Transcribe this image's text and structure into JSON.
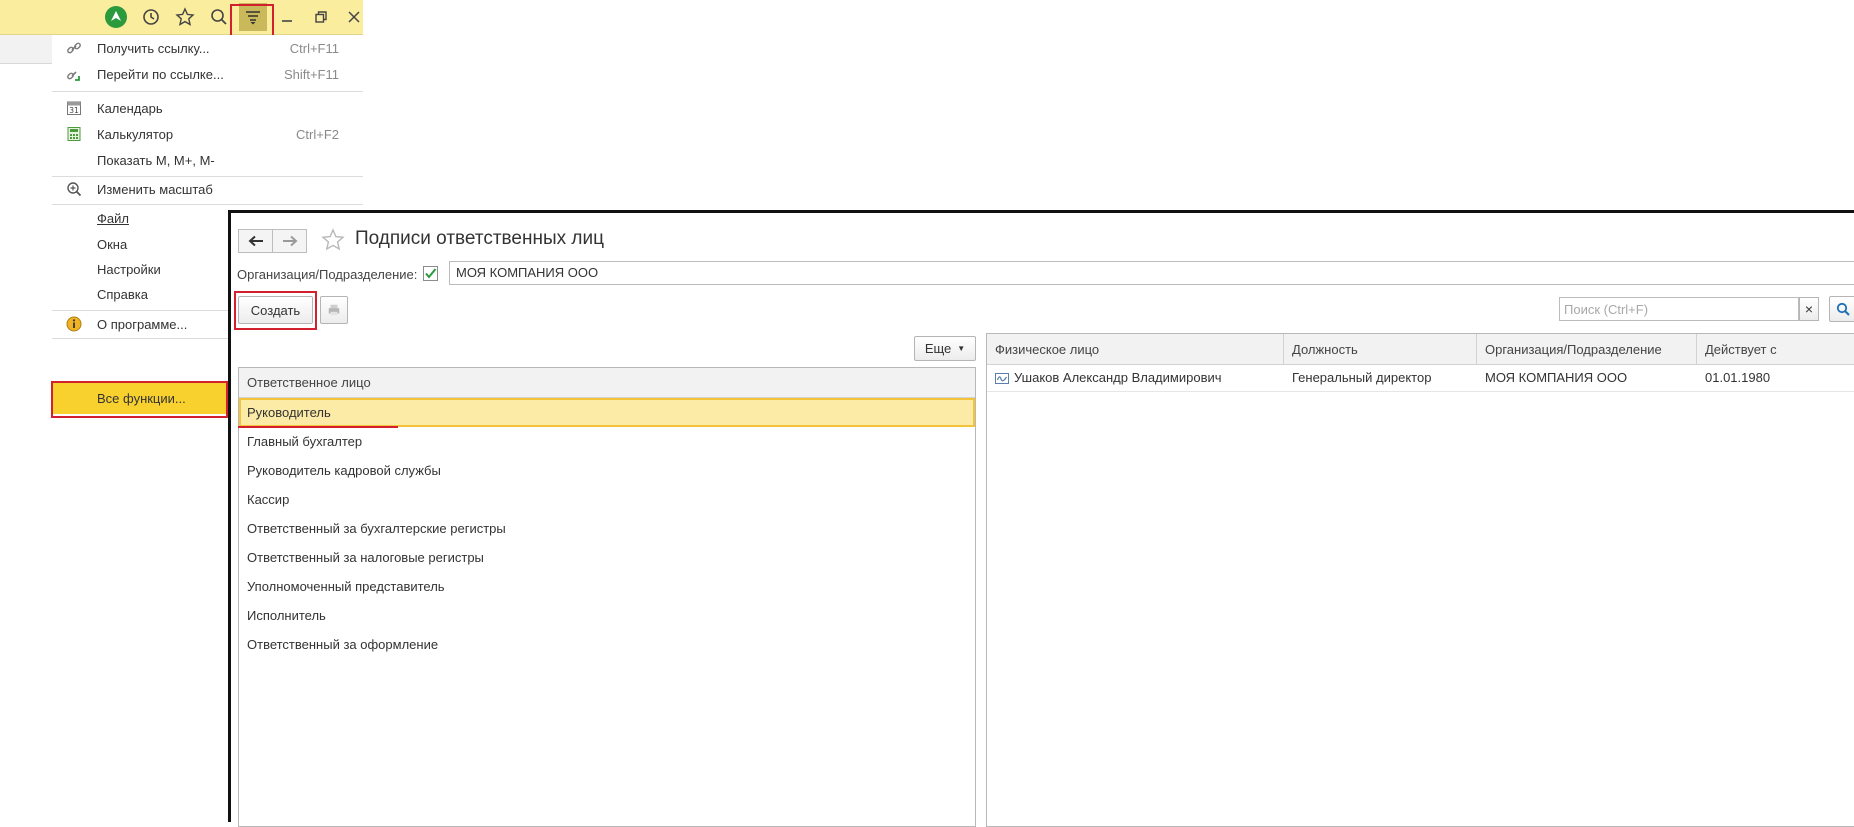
{
  "toolbar": {
    "icons": [
      "home-icon",
      "history-icon",
      "favorites-star-icon",
      "search-icon",
      "main-menu-icon",
      "minimize-icon",
      "restore-icon",
      "close-icon"
    ]
  },
  "menu": {
    "get_link": {
      "label": "Получить ссылку...",
      "shortcut": "Ctrl+F11"
    },
    "go_link": {
      "label": "Перейти по ссылке...",
      "shortcut": "Shift+F11"
    },
    "calendar": {
      "label": "Календарь",
      "icon_text": "31"
    },
    "calculator": {
      "label": "Калькулятор",
      "shortcut": "Ctrl+F2"
    },
    "show_m": {
      "label": "Показать М, М+, М-"
    },
    "zoom": {
      "label": "Изменить масштаб"
    },
    "file": {
      "label": "Файл"
    },
    "windows": {
      "label": "Окна"
    },
    "settings": {
      "label": "Настройки"
    },
    "help": {
      "label": "Справка"
    },
    "about": {
      "label": "О программе..."
    },
    "all_functions": {
      "label": "Все функции..."
    }
  },
  "form": {
    "title": "Подписи ответственных лиц",
    "org_label": "Организация/Подразделение:",
    "org_checked": true,
    "org_value": "МОЯ КОМПАНИЯ ООО",
    "create_label": "Создать",
    "more_label": "Еще",
    "search_placeholder": "Поиск (Ctrl+F)",
    "search_clear": "×"
  },
  "left_list": {
    "header": "Ответственное лицо",
    "items": [
      "Руководитель",
      "Главный бухгалтер",
      "Руководитель кадровой службы",
      "Кассир",
      "Ответственный за бухгалтерские регистры",
      "Ответственный за налоговые регистры",
      "Уполномоченный представитель",
      "Исполнитель",
      "Ответственный за оформление"
    ],
    "selected_index": 0
  },
  "right_table": {
    "columns": [
      "Физическое лицо",
      "Должность",
      "Организация/Подразделение",
      "Действует с"
    ],
    "rows": [
      [
        "Ушаков Александр Владимирович",
        "Генеральный директор",
        "МОЯ КОМПАНИЯ ООО",
        "01.01.1980"
      ]
    ]
  },
  "colors": {
    "toolbar_bg": "#fbed9e",
    "highlight": "#f8d12f",
    "selection": "#fbeba6",
    "annotation_red": "#d2202f"
  }
}
